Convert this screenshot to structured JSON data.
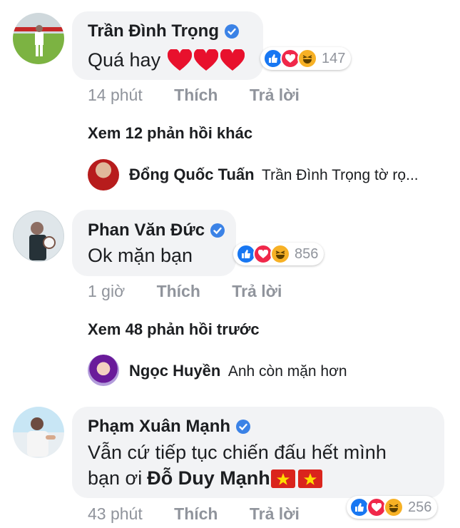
{
  "comments": [
    {
      "author": "Trần Đình Trọng",
      "text": "Quá hay",
      "reaction_count": "147",
      "time": "14 phút",
      "like_label": "Thích",
      "reply_label": "Trả lời",
      "more_replies": "Xem 12 phản hồi khác",
      "reply": {
        "author": "Đổng Quốc Tuấn",
        "text": "Trần Đình Trọng tờ rọ..."
      }
    },
    {
      "author": "Phan Văn Đức",
      "text": "Ok mặn bạn",
      "reaction_count": "856",
      "time": "1 giờ",
      "like_label": "Thích",
      "reply_label": "Trả lời",
      "more_replies": "Xem 48 phản hồi trước",
      "reply": {
        "author": "Ngọc Huyền",
        "text": "Anh còn mặn hơn"
      }
    },
    {
      "author": "Phạm Xuân Mạnh",
      "text_line1": "Vẫn cứ tiếp tục chiến đấu hết mình",
      "text_line2_prefix": "bạn ơi",
      "tagged_name": "Đỗ Duy Mạnh",
      "reaction_count": "256",
      "time": "43 phút",
      "like_label": "Thích",
      "reply_label": "Trả lời"
    }
  ],
  "colors": {
    "like": "#1877f2",
    "love": "#f0284a",
    "haha": "#f7b125",
    "verified": "#3b82e6"
  },
  "icons": [
    "verified-icon",
    "like-reaction-icon",
    "love-reaction-icon",
    "haha-reaction-icon",
    "heart-emoji",
    "vietnam-flag"
  ]
}
